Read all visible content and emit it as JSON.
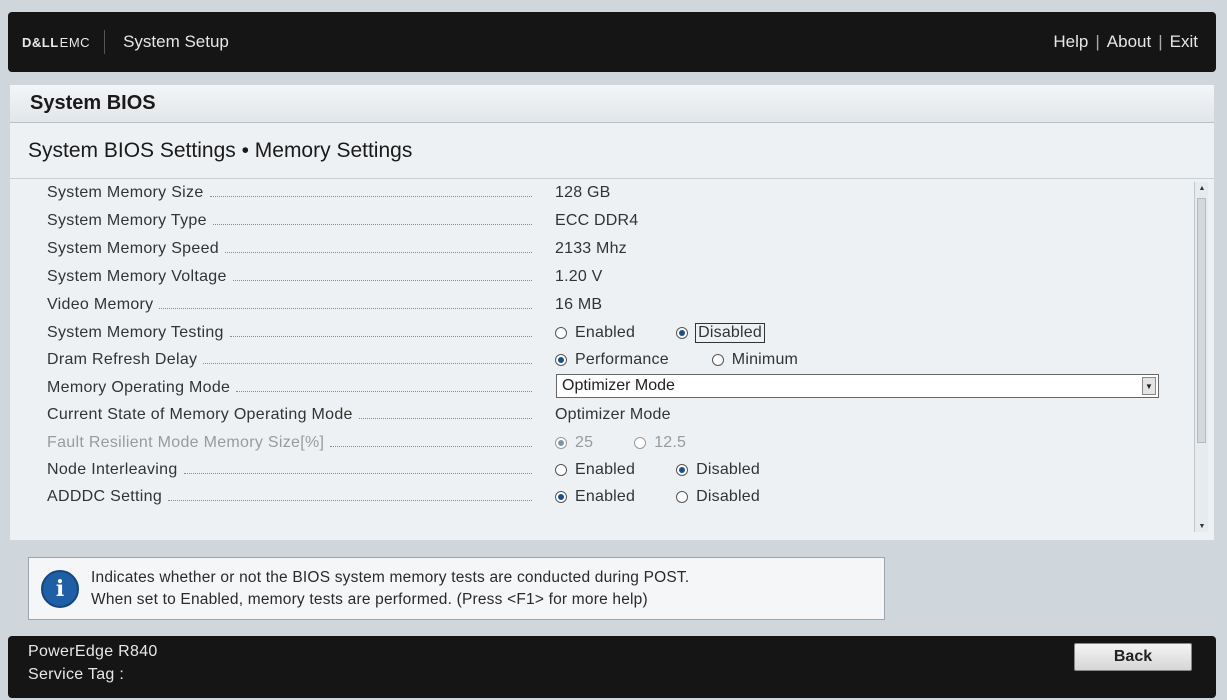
{
  "header": {
    "logo_dell": "D&LL",
    "logo_emc": "EMC",
    "title": "System Setup",
    "links": {
      "help": "Help",
      "about": "About",
      "exit": "Exit",
      "sep": "|"
    }
  },
  "panel": {
    "title": "System BIOS",
    "subtitle": "System BIOS Settings • Memory Settings"
  },
  "settings": [
    {
      "label": "System Memory Size",
      "value": "128 GB"
    },
    {
      "label": "System Memory Type",
      "value": "ECC DDR4"
    },
    {
      "label": "System Memory Speed",
      "value": "2133 Mhz"
    },
    {
      "label": "System Memory Voltage",
      "value": "1.20 V"
    },
    {
      "label": "Video Memory",
      "value": "16 MB"
    },
    {
      "label": "System Memory Testing",
      "opt1": "Enabled",
      "opt2": "Disabled",
      "selected": "Disabled"
    },
    {
      "label": "Dram Refresh Delay",
      "opt1": "Performance",
      "opt2": "Minimum",
      "selected": "Performance"
    },
    {
      "label": "Memory Operating Mode",
      "select": "Optimizer Mode"
    },
    {
      "label": "Current State of Memory Operating Mode",
      "value": "Optimizer Mode"
    },
    {
      "label": "Fault Resilient Mode Memory Size[%]",
      "opt1": "25",
      "opt2": "12.5",
      "selected": "25",
      "disabled": true
    },
    {
      "label": "Node Interleaving",
      "opt1": "Enabled",
      "opt2": "Disabled",
      "selected": "Disabled"
    },
    {
      "label": "ADDDC Setting",
      "opt1": "Enabled",
      "opt2": "Disabled",
      "selected": "Enabled"
    }
  ],
  "info": {
    "line1": "Indicates whether or not the BIOS system memory tests are conducted during POST.",
    "line2": "When set to Enabled, memory tests are performed. (Press <F1> for more help)"
  },
  "footer": {
    "model": "PowerEdge R840",
    "service_tag": "Service Tag :",
    "back": "Back"
  },
  "colors": {
    "bar": "#151515",
    "accent": "#1f5fa6"
  }
}
